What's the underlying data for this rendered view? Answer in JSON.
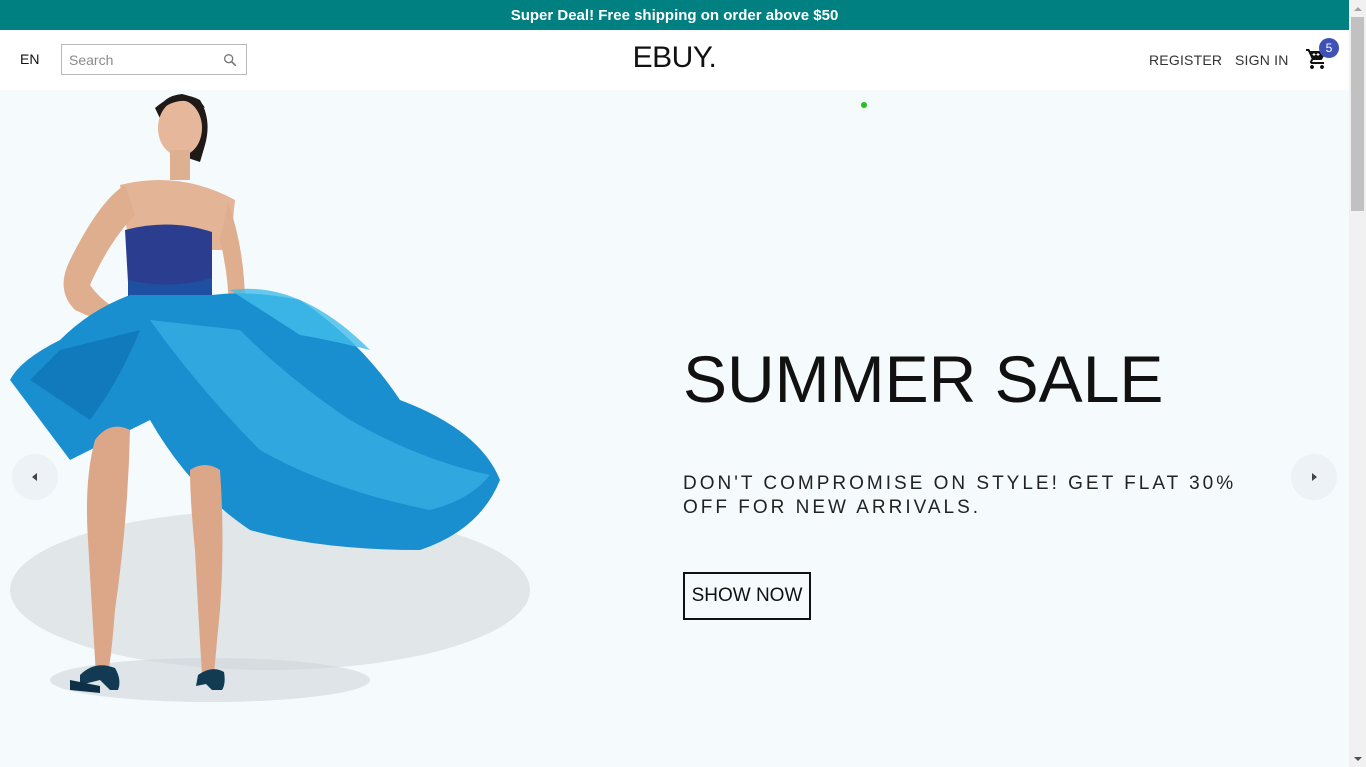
{
  "announcement": {
    "text": "Super Deal! Free shipping on order above $50"
  },
  "header": {
    "language": "EN",
    "search_placeholder": "Search",
    "logo": "EBUY.",
    "register": "REGISTER",
    "sign_in": "SIGN IN",
    "cart_count": "5"
  },
  "slider": {
    "title": "SUMMER SALE",
    "description": "DON'T COMPROMISE ON STYLE! GET FLAT 30% OFF FOR NEW ARRIVALS.",
    "button": "SHOW NOW",
    "active_dot_color": "#22c21b"
  },
  "colors": {
    "announcement_bg": "#008080",
    "badge_bg": "#3f51b5",
    "slider_bg": "#f5fafd",
    "dress_blue": "#1a8fd0"
  },
  "icons": {
    "search": "search-icon",
    "cart": "shopping-cart-icon",
    "left_arrow": "arrow-left-icon",
    "right_arrow": "arrow-right-icon"
  }
}
